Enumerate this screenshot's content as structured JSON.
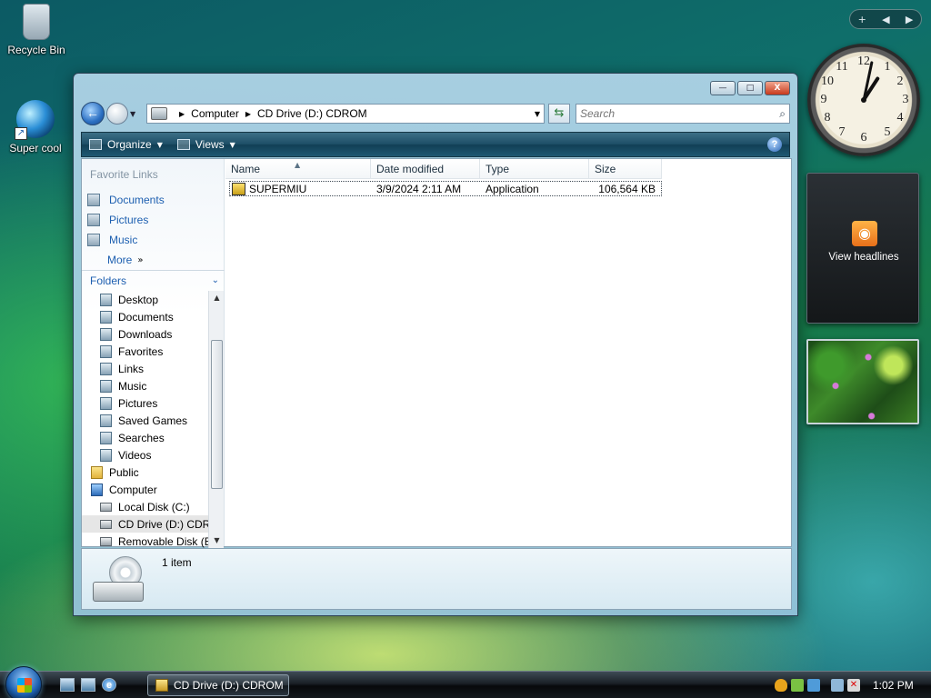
{
  "desktop": {
    "icons": [
      {
        "label": "Recycle Bin"
      },
      {
        "label": "Super cool"
      }
    ]
  },
  "window": {
    "controls": {
      "minimize": "▭",
      "maximize": "□",
      "close": "X"
    },
    "address": {
      "crumbs": [
        "Computer",
        "CD Drive (D:) CDROM"
      ],
      "search_placeholder": "Search"
    },
    "toolbar": {
      "organize": "Organize",
      "views": "Views",
      "help": "?"
    },
    "favorite_links": {
      "title": "Favorite Links",
      "items": [
        "Documents",
        "Pictures",
        "Music"
      ],
      "more": "More"
    },
    "folders": {
      "title": "Folders",
      "tree": [
        {
          "label": "Desktop",
          "icon": "desktop-icon"
        },
        {
          "label": "Documents",
          "icon": "documents-folder-icon"
        },
        {
          "label": "Downloads",
          "icon": "downloads-folder-icon"
        },
        {
          "label": "Favorites",
          "icon": "favorites-folder-icon"
        },
        {
          "label": "Links",
          "icon": "links-folder-icon"
        },
        {
          "label": "Music",
          "icon": "music-folder-icon"
        },
        {
          "label": "Pictures",
          "icon": "pictures-folder-icon"
        },
        {
          "label": "Saved Games",
          "icon": "saved-games-folder-icon"
        },
        {
          "label": "Searches",
          "icon": "searches-folder-icon"
        },
        {
          "label": "Videos",
          "icon": "videos-folder-icon"
        },
        {
          "label": "Public",
          "icon": "folder-icon"
        },
        {
          "label": "Computer",
          "icon": "computer-icon"
        },
        {
          "label": "Local Disk (C:)",
          "icon": "local-disk-icon"
        },
        {
          "label": "CD Drive (D:) CDRO",
          "icon": "cd-drive-icon"
        },
        {
          "label": "Removable Disk (E",
          "icon": "removable-disk-icon"
        }
      ]
    },
    "columns": [
      "Name",
      "Date modified",
      "Type",
      "Size"
    ],
    "files": [
      {
        "name": "SUPERMIU",
        "date": "3/9/2024 2:11 AM",
        "type": "Application",
        "size": "106,564 KB"
      }
    ],
    "details": {
      "count": "1 item"
    }
  },
  "gadgets": {
    "toolbar": {
      "add": "+",
      "prev": "◀",
      "next": "▶"
    },
    "clock_numbers": [
      "12",
      "1",
      "2",
      "3",
      "4",
      "5",
      "6",
      "7",
      "8",
      "9",
      "10",
      "11"
    ],
    "feed_label": "View headlines"
  },
  "taskbar": {
    "task_label": "CD Drive (D:) CDROM",
    "time": "1:02 PM"
  }
}
